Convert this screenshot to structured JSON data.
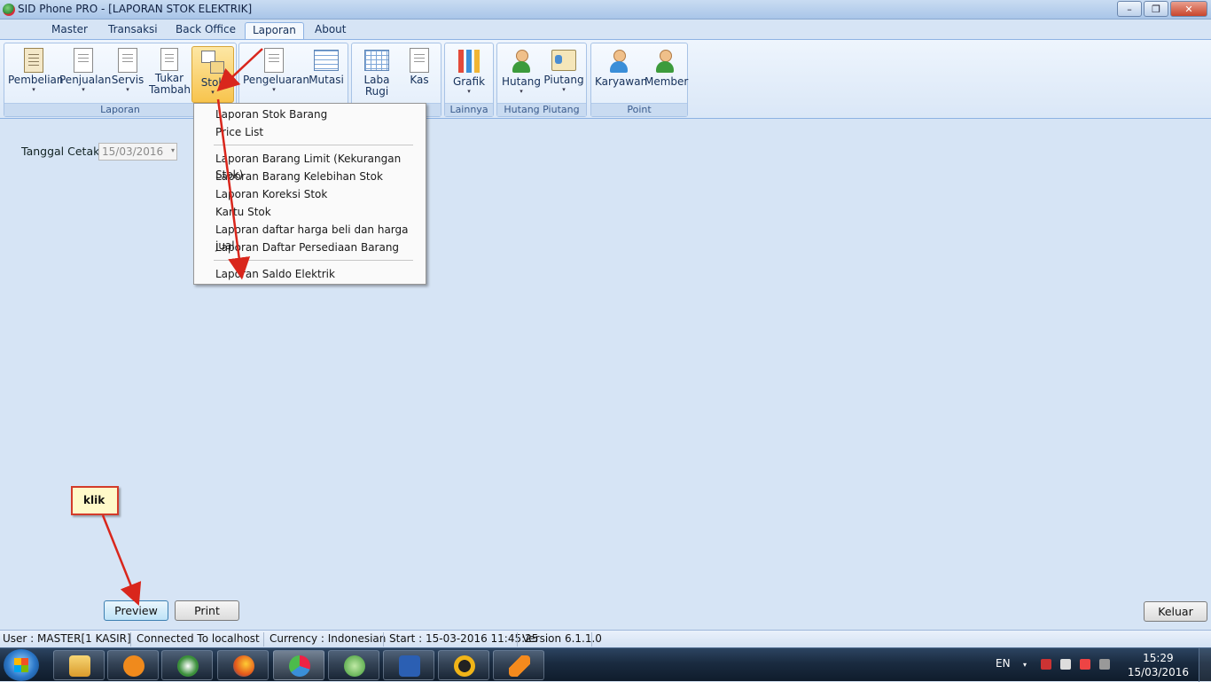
{
  "window": {
    "title": "SID Phone PRO - [LAPORAN STOK ELEKTRIK]",
    "minimize": "–",
    "maximize": "❐",
    "close": "✕"
  },
  "tabs": [
    {
      "label": "Master"
    },
    {
      "label": "Transaksi"
    },
    {
      "label": "Back Office"
    },
    {
      "label": "Laporan",
      "active": true
    },
    {
      "label": "About"
    }
  ],
  "ribbon": {
    "groups": {
      "laporan": {
        "label": "Laporan"
      },
      "lainnya": {
        "label": "Lainnya"
      },
      "hutang_piutang": {
        "label": "Hutang Piutang"
      },
      "point": {
        "label": "Point"
      }
    },
    "buttons": {
      "pembelian": {
        "label": "Pembelian",
        "icon": "document-scroll-icon"
      },
      "penjualan": {
        "label": "Penjualan",
        "icon": "documents-icon"
      },
      "servis": {
        "label": "Servis",
        "icon": "font-document-icon"
      },
      "tukar_tambah_1": {
        "label": "Tukar"
      },
      "tukar_tambah_2": {
        "label": "Tambah"
      },
      "stok": {
        "label": "Stok",
        "icon": "boxes-icon"
      },
      "pengeluaran": {
        "label": "Pengeluaran",
        "icon": "numbered-document-icon"
      },
      "mutasi": {
        "label": "Mutasi",
        "icon": "transfer-icon"
      },
      "laba_rugi_1": {
        "label": "Laba"
      },
      "laba_rugi_2": {
        "label": "Rugi"
      },
      "kas": {
        "label": "Kas",
        "icon": "document-icon"
      },
      "grafik": {
        "label": "Grafik",
        "icon": "bar-chart-icon"
      },
      "hutang": {
        "label": "Hutang",
        "icon": "person-speech-icon"
      },
      "piutang": {
        "label": "Piutang",
        "icon": "id-card-icon"
      },
      "karyawan": {
        "label": "Karyawan",
        "icon": "person-icon"
      },
      "member": {
        "label": "Member",
        "icon": "people-icon"
      }
    },
    "dropdown_glyph": "▾"
  },
  "stok_menu": {
    "items": [
      "Laporan Stok Barang",
      "Price List",
      "Laporan Barang Limit (Kekurangan Stok)",
      "Laporan Barang Kelebihan Stok",
      "Laporan Koreksi Stok",
      "Kartu Stok",
      "Laporan daftar harga beli dan harga jual",
      "Laporan Daftar Persediaan Barang",
      "Laporan Saldo Elektrik"
    ]
  },
  "form": {
    "tanggal_label": "Tanggal Cetak",
    "tanggal_value": "15/03/2016",
    "preview_label": "Preview",
    "print_label": "Print",
    "keluar_label": "Keluar"
  },
  "annotation": {
    "callout_text": "klik",
    "arrow_color": "#d9261c"
  },
  "statusbar": {
    "user": "User : MASTER[1 KASIR]",
    "connection": "Connected To localhost",
    "currency": "Currency : Indonesian",
    "start": "Start  : 15-03-2016 11:45:25",
    "version": "Version 6.1.1.0"
  },
  "taskbar": {
    "apps": [
      "explorer-icon",
      "media-player-icon",
      "media-center-icon",
      "firefox-icon",
      "sid-phone-icon",
      "green-app-icon",
      "word-icon",
      "app-a-icon",
      "vlc-icon"
    ],
    "language": "EN",
    "time": "15:29",
    "date": "15/03/2016"
  },
  "colors": {
    "ribbon_highlight": "#f8c44d",
    "accent_blue": "#8db2e3",
    "annotation_red": "#d9261c"
  }
}
